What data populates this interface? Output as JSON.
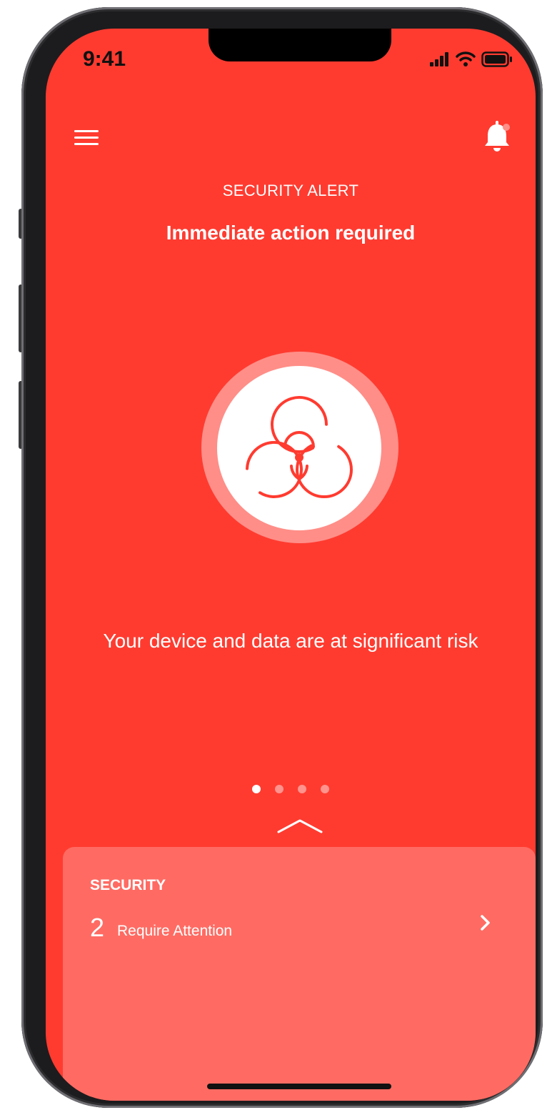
{
  "status_bar": {
    "time": "9:41",
    "icons": [
      "cellular-signal-icon",
      "wifi-icon",
      "battery-icon"
    ]
  },
  "header": {
    "menu_icon": "hamburger-menu-icon",
    "notification_icon": "bell-icon"
  },
  "alert": {
    "label": "SECURITY ALERT",
    "title": "Immediate action required",
    "icon": "biohazard-icon",
    "message": "Your device and data are at significant risk"
  },
  "pager": {
    "total": 4,
    "active_index": 0
  },
  "panel": {
    "title": "SECURITY",
    "count": "2",
    "count_label": "Require Attention",
    "arrow_icon": "chevron-right-icon",
    "expand_icon": "chevron-up-icon"
  },
  "colors": {
    "background": "#ff3b30",
    "panel": "#ff6b63",
    "hazard_ring": "#ff8e88",
    "text": "#ffffff"
  }
}
